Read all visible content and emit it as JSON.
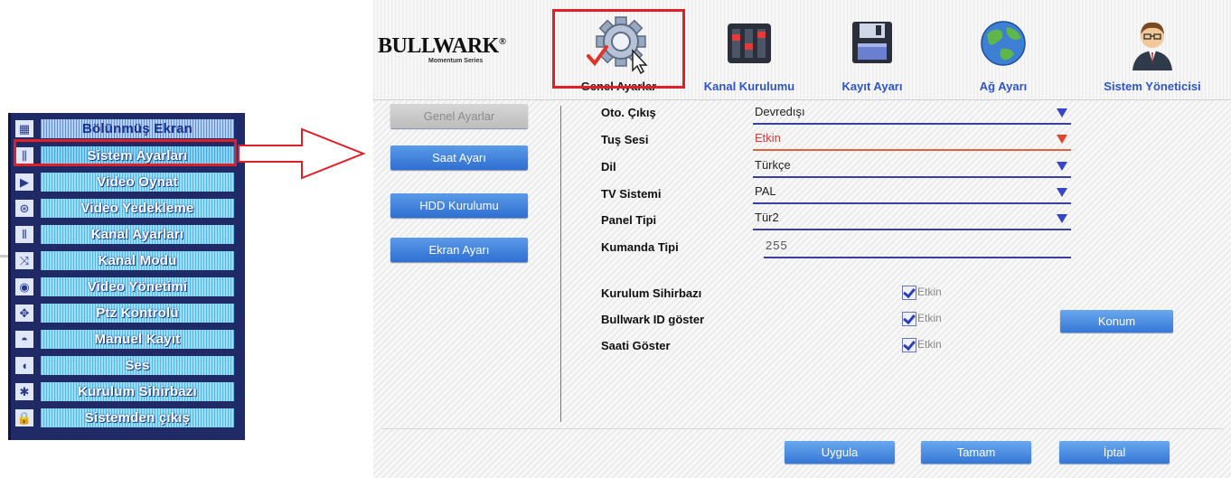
{
  "side_menu": {
    "items": [
      {
        "label": "Bölünmüş Ekran",
        "icon": "split-screen-icon",
        "glyph": "▦"
      },
      {
        "label": "Sistem Ayarları",
        "icon": "system-settings-icon",
        "glyph": "⫼"
      },
      {
        "label": "Video Oynat",
        "icon": "play-icon",
        "glyph": "▶"
      },
      {
        "label": "Video Yedekleme",
        "icon": "backup-icon",
        "glyph": "⊛"
      },
      {
        "label": "Kanal Ayarları",
        "icon": "channel-settings-icon",
        "glyph": "⫴"
      },
      {
        "label": "Kanal Modu",
        "icon": "channel-mode-icon",
        "glyph": "⤨"
      },
      {
        "label": "Video Yönetimi",
        "icon": "video-management-icon",
        "glyph": "◉"
      },
      {
        "label": "Ptz Kontrolü",
        "icon": "ptz-icon",
        "glyph": "✥"
      },
      {
        "label": "Manuel Kayıt",
        "icon": "manual-record-icon",
        "glyph": "◓"
      },
      {
        "label": "Ses",
        "icon": "audio-icon",
        "glyph": "◖"
      },
      {
        "label": "Kurulum Sihirbazı",
        "icon": "wizard-icon",
        "glyph": "✱"
      },
      {
        "label": "Sistemden çıkış",
        "icon": "lock-icon",
        "glyph": "🔒"
      }
    ],
    "selected_index": 1
  },
  "dvr": {
    "brand": "BULLWARK",
    "brand_mark": "®",
    "brand_sub": "Momentum Series",
    "tabs": [
      {
        "label": "Genel Ayarlar",
        "icon": "gear-icon"
      },
      {
        "label": "Kanal Kurulumu",
        "icon": "mixer-icon"
      },
      {
        "label": "Kayıt Ayarı",
        "icon": "floppy-disk-icon"
      },
      {
        "label": "Ağ Ayarı",
        "icon": "globe-icon"
      },
      {
        "label": "Sistem Yöneticisi",
        "icon": "admin-user-icon"
      }
    ],
    "active_tab_index": 0,
    "side_buttons": [
      "Genel Ayarlar",
      "Saat Ayarı",
      "HDD Kurulumu",
      "Ekran Ayarı"
    ],
    "fields": [
      {
        "label": "Oto. Çıkış",
        "value": "Devredışı"
      },
      {
        "label": "Tuş Sesi",
        "value": "Etkin"
      },
      {
        "label": "Dil",
        "value": "Türkçe"
      },
      {
        "label": "TV Sistemi",
        "value": "PAL"
      },
      {
        "label": "Panel Tipi",
        "value": "Tür2"
      },
      {
        "label": "Kumanda Tipi",
        "value": "255"
      }
    ],
    "checkboxes": [
      {
        "label": "Kurulum Sihirbazı",
        "text": "Etkin",
        "checked": true
      },
      {
        "label": "Bullwark ID göster",
        "text": "Etkin",
        "checked": true
      },
      {
        "label": "Saati Göster",
        "text": "Etkin",
        "checked": true
      }
    ],
    "konum_button": "Konum",
    "footer_buttons": [
      "Uygula",
      "Tamam",
      "İptal"
    ]
  },
  "colors": {
    "highlight_red": "#e01f26",
    "menu_bg": "#1f2a66",
    "button_blue": "#3477d6",
    "tab_label_blue": "#2d55c9"
  }
}
